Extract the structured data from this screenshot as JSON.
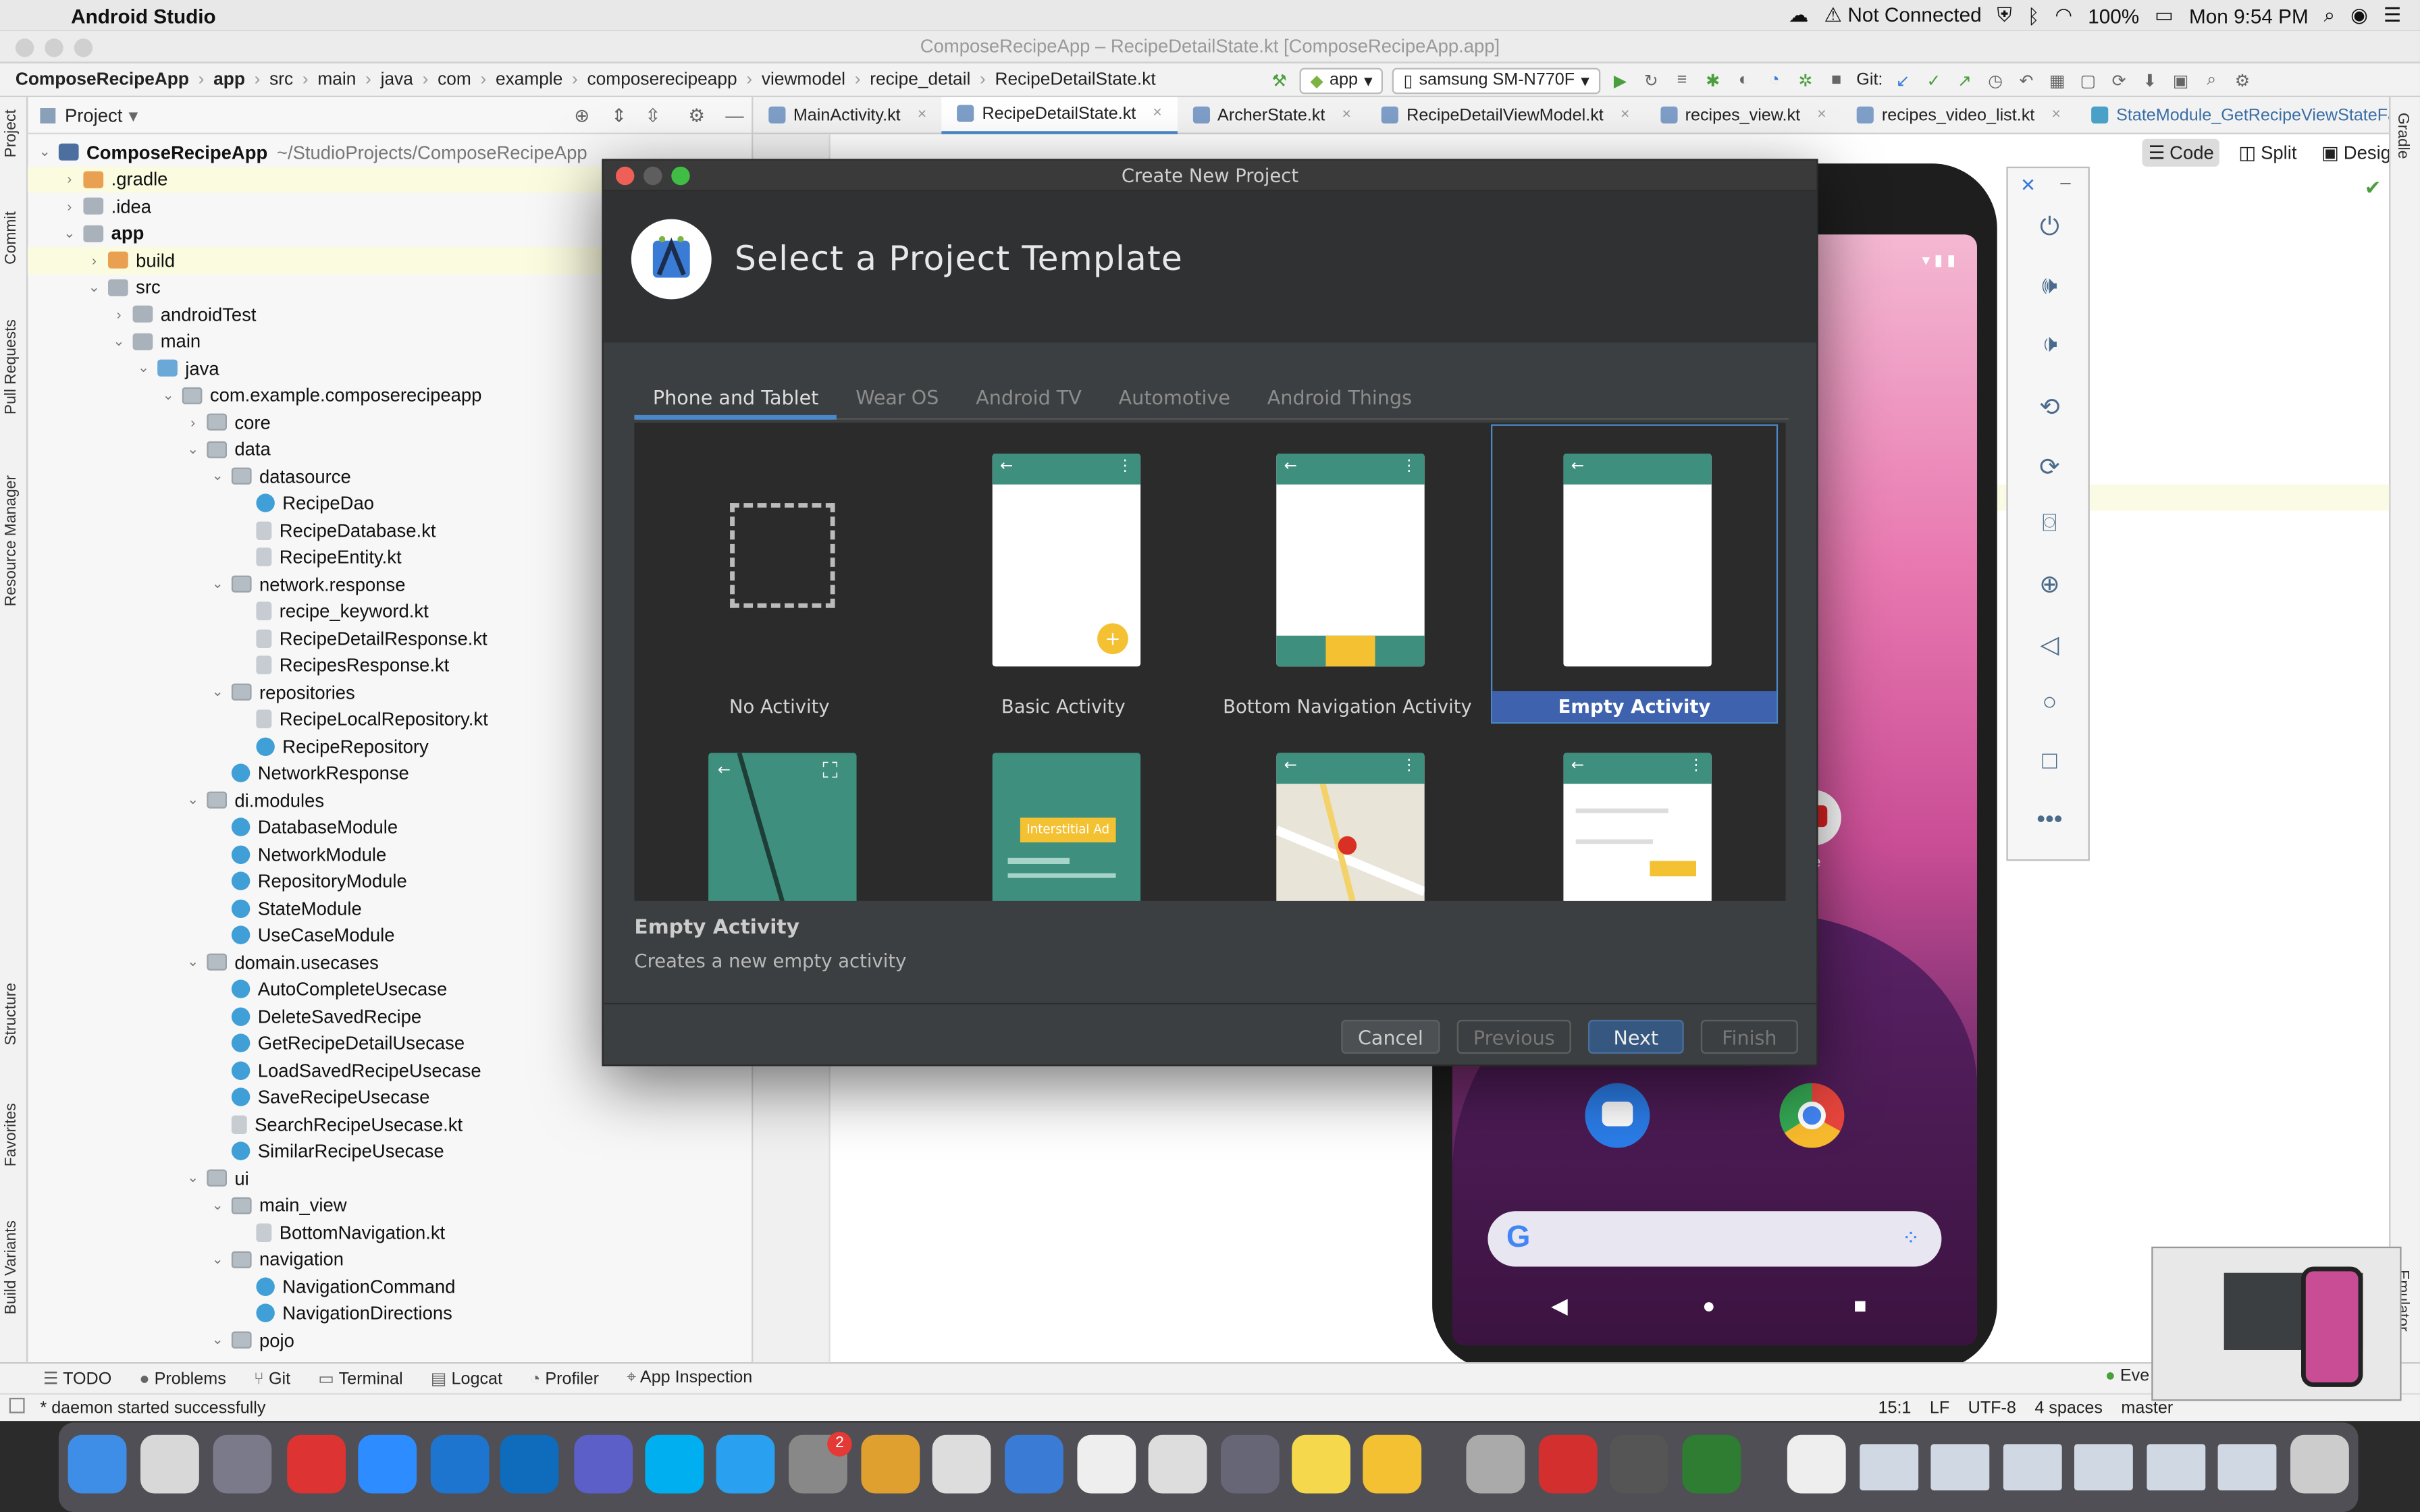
{
  "menubar": {
    "app_name": "Android Studio",
    "network": "Not Connected",
    "battery": "100%",
    "clock": "Mon 9:54 PM"
  },
  "window": {
    "title": "ComposeRecipeApp – RecipeDetailState.kt [ComposeRecipeApp.app]"
  },
  "breadcrumb": [
    "ComposeRecipeApp",
    "app",
    "src",
    "main",
    "java",
    "com",
    "example",
    "composerecipeapp",
    "viewmodel",
    "recipe_detail",
    "RecipeDetailState.kt"
  ],
  "toolbar": {
    "run_config": "app",
    "device": "samsung SM-N770F",
    "git_label": "Git:"
  },
  "left_strip": [
    "Project",
    "Commit",
    "Pull Requests",
    "Resource Manager",
    "Structure",
    "Favorites",
    "Build Variants"
  ],
  "project_panel": {
    "header": "Project",
    "root_path": "~/StudioProjects/ComposeRecipeApp",
    "tree": [
      {
        "label": "ComposeRecipeApp",
        "kind": "proj",
        "arrow": "⌄",
        "bold": true
      },
      {
        "label": ".gradle",
        "kind": "folder-orange",
        "arrow": "›"
      },
      {
        "label": ".idea",
        "kind": "folder",
        "arrow": "›"
      },
      {
        "label": "app",
        "kind": "folder",
        "arrow": "⌄",
        "bold": true
      },
      {
        "label": "build",
        "kind": "folder-orange",
        "arrow": "›"
      },
      {
        "label": "src",
        "kind": "folder",
        "arrow": "⌄"
      },
      {
        "label": "androidTest",
        "kind": "folder",
        "arrow": "›"
      },
      {
        "label": "main",
        "kind": "folder",
        "arrow": "⌄"
      },
      {
        "label": "java",
        "kind": "folder-blue",
        "arrow": "⌄"
      },
      {
        "label": "com.example.composerecipeapp",
        "kind": "pkg",
        "arrow": "⌄"
      },
      {
        "label": "core",
        "kind": "pkg",
        "arrow": "›"
      },
      {
        "label": "data",
        "kind": "pkg",
        "arrow": "⌄"
      },
      {
        "label": "datasource",
        "kind": "pkg",
        "arrow": "⌄"
      },
      {
        "label": "RecipeDao",
        "kind": "cls",
        "arrow": ""
      },
      {
        "label": "RecipeDatabase.kt",
        "kind": "file",
        "arrow": ""
      },
      {
        "label": "RecipeEntity.kt",
        "kind": "file",
        "arrow": ""
      },
      {
        "label": "network.response",
        "kind": "pkg",
        "arrow": "⌄"
      },
      {
        "label": "recipe_keyword.kt",
        "kind": "file",
        "arrow": ""
      },
      {
        "label": "RecipeDetailResponse.kt",
        "kind": "file",
        "arrow": ""
      },
      {
        "label": "RecipesResponse.kt",
        "kind": "file",
        "arrow": ""
      },
      {
        "label": "repositories",
        "kind": "pkg",
        "arrow": "⌄"
      },
      {
        "label": "RecipeLocalRepository.kt",
        "kind": "file",
        "arrow": ""
      },
      {
        "label": "RecipeRepository",
        "kind": "cls",
        "arrow": ""
      },
      {
        "label": "NetworkResponse",
        "kind": "cls",
        "arrow": ""
      },
      {
        "label": "di.modules",
        "kind": "pkg",
        "arrow": "⌄"
      },
      {
        "label": "DatabaseModule",
        "kind": "cls",
        "arrow": ""
      },
      {
        "label": "NetworkModule",
        "kind": "cls",
        "arrow": ""
      },
      {
        "label": "RepositoryModule",
        "kind": "cls",
        "arrow": ""
      },
      {
        "label": "StateModule",
        "kind": "cls",
        "arrow": ""
      },
      {
        "label": "UseCaseModule",
        "kind": "cls",
        "arrow": ""
      },
      {
        "label": "domain.usecases",
        "kind": "pkg",
        "arrow": "⌄"
      },
      {
        "label": "AutoCompleteUsecase",
        "kind": "cls",
        "arrow": ""
      },
      {
        "label": "DeleteSavedRecipe",
        "kind": "cls",
        "arrow": ""
      },
      {
        "label": "GetRecipeDetailUsecase",
        "kind": "cls",
        "arrow": ""
      },
      {
        "label": "LoadSavedRecipeUsecase",
        "kind": "cls",
        "arrow": ""
      },
      {
        "label": "SaveRecipeUsecase",
        "kind": "cls",
        "arrow": ""
      },
      {
        "label": "SearchRecipeUsecase.kt",
        "kind": "file",
        "arrow": ""
      },
      {
        "label": "SimilarRecipeUsecase",
        "kind": "cls",
        "arrow": ""
      },
      {
        "label": "ui",
        "kind": "pkg",
        "arrow": "⌄"
      },
      {
        "label": "main_view",
        "kind": "pkg",
        "arrow": "⌄"
      },
      {
        "label": "BottomNavigation.kt",
        "kind": "file",
        "arrow": ""
      },
      {
        "label": "navigation",
        "kind": "pkg",
        "arrow": "⌄"
      },
      {
        "label": "NavigationCommand",
        "kind": "cls",
        "arrow": ""
      },
      {
        "label": "NavigationDirections",
        "kind": "cls",
        "arrow": ""
      },
      {
        "label": "pojo",
        "kind": "pkg",
        "arrow": "⌄"
      }
    ]
  },
  "editor_tabs": [
    {
      "label": "MainActivity.kt",
      "active": false
    },
    {
      "label": "RecipeDetailState.kt",
      "active": true
    },
    {
      "label": "ArcherState.kt",
      "active": false
    },
    {
      "label": "RecipeDetailViewModel.kt",
      "active": false
    },
    {
      "label": "recipes_view.kt",
      "active": false
    },
    {
      "label": "recipes_video_list.kt",
      "active": false
    },
    {
      "label": "StateModule_GetRecipeViewStateFactory.java",
      "active": false
    }
  ],
  "view_modes": {
    "code": "Code",
    "split": "Split",
    "design": "Design"
  },
  "right_strip": [
    "Gradle",
    "Emulator"
  ],
  "bottom_tools": [
    "TODO",
    "Problems",
    "Git",
    "Terminal",
    "Logcat",
    "Profiler",
    "App Inspection"
  ],
  "event_log": "Eve",
  "status": {
    "message": "* daemon started successfully",
    "position": "15:1",
    "line_sep": "LF",
    "encoding": "UTF-8",
    "indent": "4 spaces",
    "branch": "master"
  },
  "phone": {
    "app_label": "ube"
  },
  "dialog": {
    "title": "Create New Project",
    "heading": "Select a Project Template",
    "tabs": [
      "Phone and Tablet",
      "Wear OS",
      "Android TV",
      "Automotive",
      "Android Things"
    ],
    "active_tab": "Phone and Tablet",
    "templates": [
      "No Activity",
      "Basic Activity",
      "Bottom Navigation Activity",
      "Empty Activity"
    ],
    "selected_template": "Empty Activity",
    "interstitial_label": "Interstitial Ad",
    "desc_title": "Empty Activity",
    "desc_text": "Creates a new empty activity",
    "buttons": {
      "cancel": "Cancel",
      "previous": "Previous",
      "next": "Next",
      "finish": "Finish"
    }
  },
  "dock_badge": "2",
  "colors": {
    "accent": "#4a88c7",
    "template_green": "#3e8f7e",
    "selected": "#3e62ad",
    "dialog_bg": "#3c3f41"
  }
}
